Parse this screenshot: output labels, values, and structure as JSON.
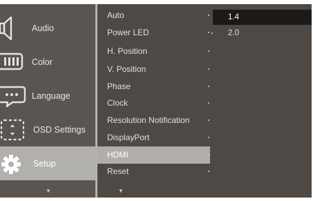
{
  "categories": [
    {
      "label": "Audio",
      "icon": "speaker-icon"
    },
    {
      "label": "Color",
      "icon": "color-icon"
    },
    {
      "label": "Language",
      "icon": "language-icon"
    },
    {
      "label": "OSD Settings",
      "icon": "osd-settings-icon"
    },
    {
      "label": "Setup",
      "icon": "gear-icon",
      "active": true
    }
  ],
  "setup_items": [
    {
      "label": "Auto"
    },
    {
      "label": "Power LED"
    },
    {
      "label": "H. Position"
    },
    {
      "label": "V. Position"
    },
    {
      "label": "Phase"
    },
    {
      "label": "Clock"
    },
    {
      "label": "Resolution Notification"
    },
    {
      "label": "DisplayPort"
    },
    {
      "label": "HDMI",
      "active": true
    },
    {
      "label": "Reset"
    }
  ],
  "hdmi_options": [
    {
      "label": "1.4",
      "selected": true
    },
    {
      "label": "2.0"
    }
  ],
  "arrows": {
    "left": "▼",
    "middle": "▼"
  },
  "colors": {
    "panel_dark": "#4e4944",
    "highlight": "#b0aeab",
    "selected_option": "#1c1a18"
  }
}
